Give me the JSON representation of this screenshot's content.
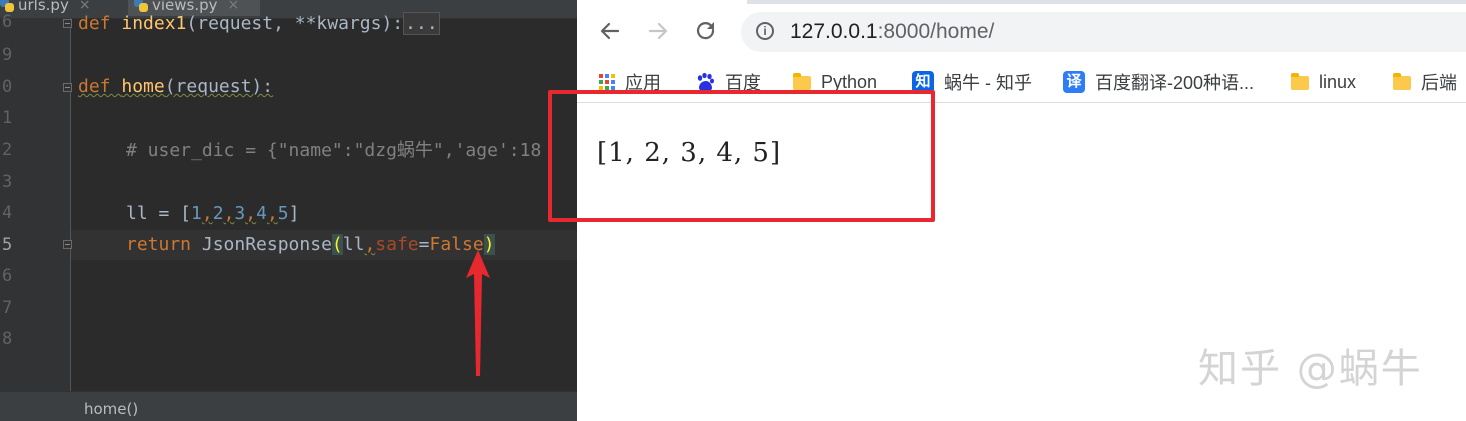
{
  "ide": {
    "tabs": [
      {
        "label": "urls.py",
        "close": "×"
      },
      {
        "label": "views.py",
        "close": "×"
      }
    ],
    "line_numbers": [
      "6",
      "9",
      "0",
      "1",
      "2",
      "3",
      "4",
      "5",
      "6",
      "7",
      "8"
    ],
    "code": {
      "line1": {
        "kw": "def ",
        "fn": "index1",
        "rest": "(request, **kwargs):",
        "folded": "..."
      },
      "line2": {
        "kw": "def ",
        "fn": "home",
        "rest": "(request):"
      },
      "line3": {
        "text": "# user_dic = {\"name\":\"dzg蜗牛\",'age':18"
      },
      "line4": {
        "prefix": "ll = [",
        "n1": "1",
        "c": ",",
        "n2": "2",
        "n3": "3",
        "n4": "4",
        "n5": "5",
        "suffix": "]"
      },
      "line5": {
        "kw": "return ",
        "call": "JsonResponse",
        "open": "(",
        "arg": "ll",
        "comma": ",",
        "param": "safe",
        "eq": "=",
        "val": "False",
        "close": ")"
      }
    },
    "breadcrumb": "home()"
  },
  "browser": {
    "nav": {
      "back": "back-icon",
      "forward": "forward-icon",
      "reload": "reload-icon"
    },
    "url": {
      "host": "127.0.0.1",
      "rest": ":8000/home/"
    },
    "bookmarks": [
      {
        "label": "应用",
        "icon": "apps-icon"
      },
      {
        "label": "百度",
        "icon": "baidu-icon"
      },
      {
        "label": "Python",
        "icon": "folder-icon"
      },
      {
        "label": "蜗牛 - 知乎",
        "icon": "zhihu-icon",
        "icon_text": "知"
      },
      {
        "label": "百度翻译-200种语...",
        "icon": "translate-icon",
        "icon_text": "译"
      },
      {
        "label": "linux",
        "icon": "folder-icon"
      },
      {
        "label": "后端",
        "icon": "folder-icon"
      }
    ],
    "content": "[1, 2, 3, 4, 5]"
  },
  "watermark": "知乎 @蜗牛",
  "colors": {
    "ide_bg": "#2b2b2b",
    "keyword": "#cc7832",
    "function": "#ffc66d",
    "number": "#6897bb",
    "annotation_red": "#e8282f"
  }
}
